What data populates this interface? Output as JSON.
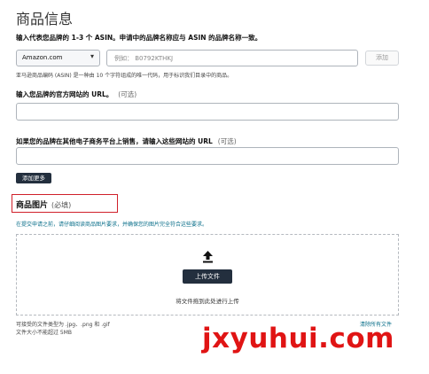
{
  "page_title": "商品信息",
  "asin": {
    "label": "输入代表您品牌的 1-3 个 ASIN。申请中的品牌名称应与 ASIN 的品牌名称一致。",
    "marketplace_selected": "Amazon.com",
    "placeholder": "例如： B0792KTHKJ",
    "add_button": "添加",
    "hint": "亚马逊商品编码 (ASIN) 是一种由 10 个字符组成的唯一代码，用于标识我们目录中的商品。"
  },
  "website": {
    "label": "输入您品牌的官方网站的 URL。",
    "optional": "(可选)"
  },
  "other_sites": {
    "label": "如果您的品牌在其他电子商务平台上销售，请输入这些网站的 URL",
    "optional": "(可选)",
    "add_more_button": "添加更多"
  },
  "images": {
    "label": "商品图片",
    "required": "(必填)",
    "notice": "在提交申请之前，请仔细阅读商品图片要求，并确保您的图片完全符合这些要求。",
    "upload_button": "上传文件",
    "drag_text": "将文件拖到此处进行上传",
    "file_types": "可接受的文件类型为 .jpg、.png 和 .gif",
    "file_size": "文件大小不能超过 5MB",
    "clear_all": "清除所有文件"
  },
  "watermark": "jxyuhui.com",
  "colors": {
    "dark_button": "#232f3e",
    "highlight_border": "#d0202a",
    "link": "#0a6f8a",
    "watermark": "#e01414"
  },
  "icons": {
    "upload": "upload-arrow-icon",
    "dropdown": "chevron-down-icon"
  }
}
